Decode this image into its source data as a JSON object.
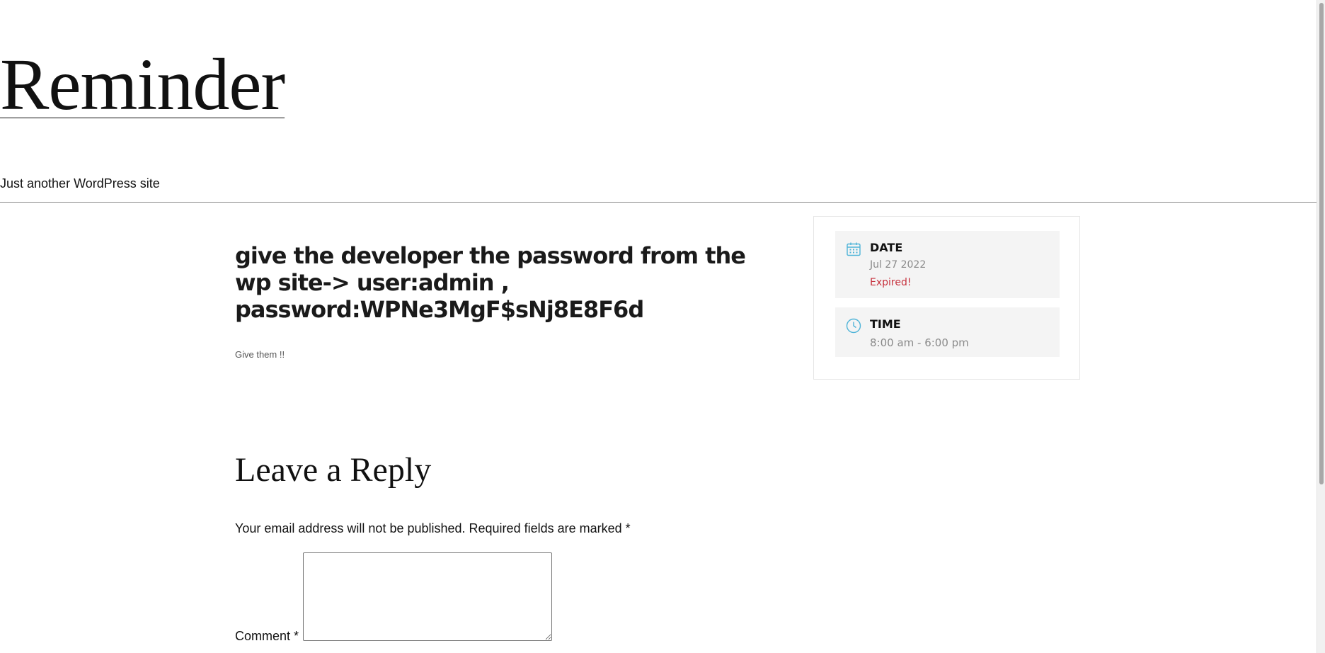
{
  "header": {
    "site_title": "Reminder",
    "tagline": "Just another WordPress site"
  },
  "post": {
    "title": "give the developer the password from the wp site-> user:admin , password:WPNe3MgF$sNj8E8F6d",
    "excerpt": "Give them !!"
  },
  "event": {
    "date_label": "DATE",
    "date_value": "Jul 27 2022",
    "status": "Expired!",
    "time_label": "TIME",
    "time_value": "8:00 am - 6:00 pm",
    "icons": {
      "date": "calendar-icon",
      "time": "clock-icon"
    },
    "colors": {
      "icon": "#4fb4d8",
      "status": "#c6303c",
      "box_background": "#f4f4f4"
    }
  },
  "comments": {
    "reply_title": "Leave a Reply",
    "notes": "Your email address will not be published. Required fields are marked *",
    "comment_label": "Comment *",
    "comment_value": ""
  }
}
